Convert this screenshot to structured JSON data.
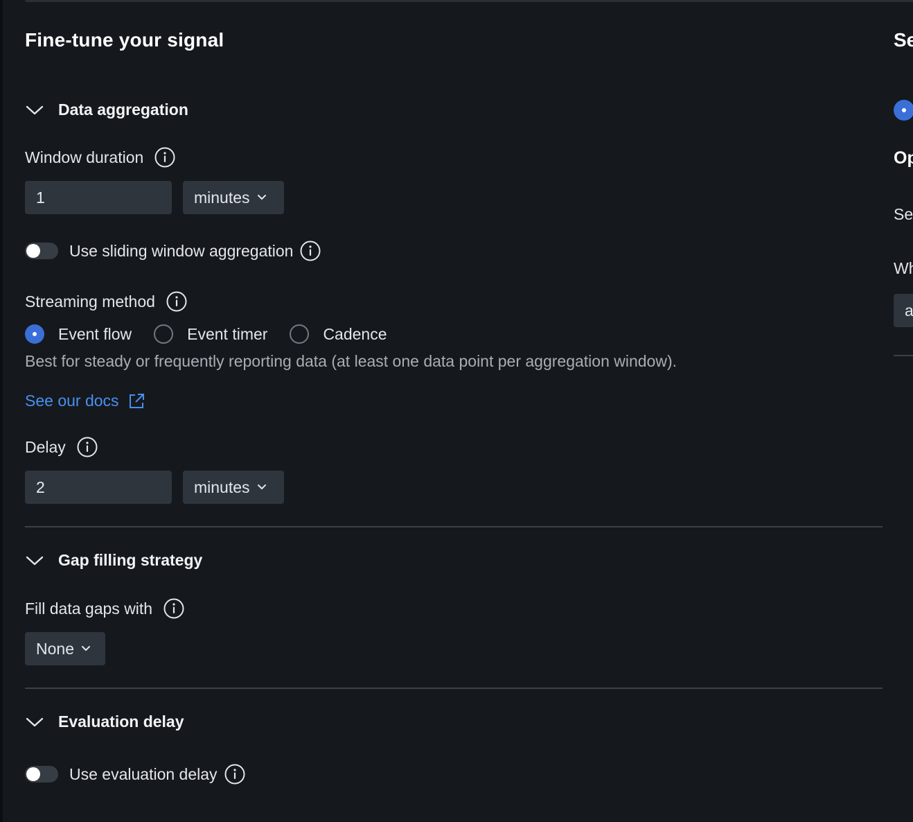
{
  "panel": {
    "title": "Fine-tune your signal"
  },
  "data_aggregation": {
    "heading": "Data aggregation",
    "window_duration": {
      "label": "Window duration",
      "value": "1",
      "unit": "minutes"
    },
    "sliding_window": {
      "label": "Use sliding window aggregation",
      "enabled": false
    },
    "streaming_method": {
      "label": "Streaming method",
      "options": [
        "Event flow",
        "Event timer",
        "Cadence"
      ],
      "selected": "Event flow",
      "hint": "Best for steady or frequently reporting data (at least one data point per aggregation window).",
      "docs_link": "See our docs"
    },
    "delay": {
      "label": "Delay",
      "value": "2",
      "unit": "minutes"
    }
  },
  "gap_filling": {
    "heading": "Gap filling strategy",
    "fill_label": "Fill data gaps with",
    "fill_value": "None"
  },
  "evaluation_delay": {
    "heading": "Evaluation delay",
    "toggle_label": "Use evaluation delay",
    "enabled": false
  },
  "right_panel_partial": {
    "heading": "Se",
    "subheading": "Op",
    "line1": "Se",
    "line2": "Wh",
    "input_value": "a"
  },
  "colors": {
    "background": "#15191d",
    "accent": "#3b6fd8",
    "link": "#4a8ef0",
    "input_bg": "#2e353d"
  }
}
